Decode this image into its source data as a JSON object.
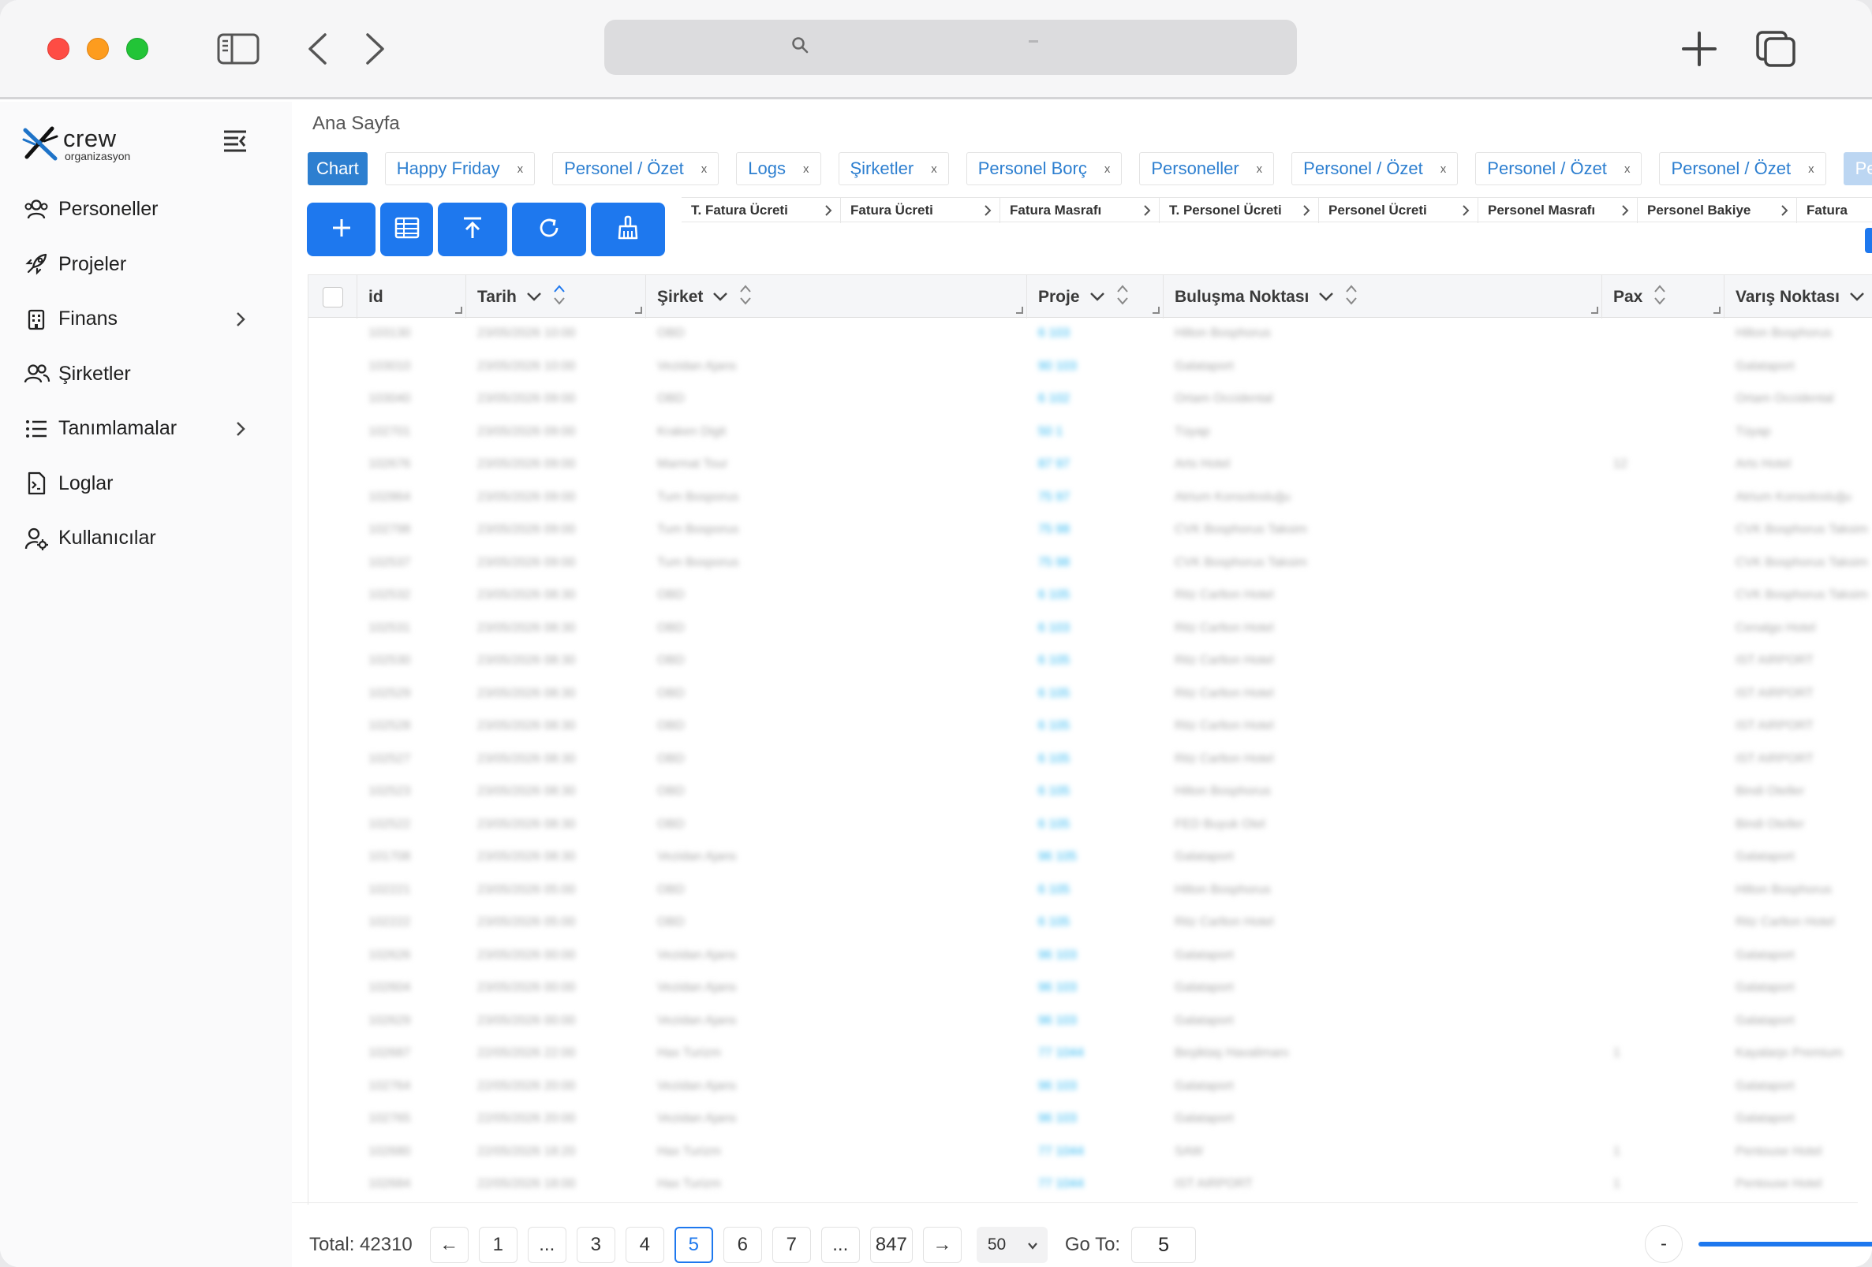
{
  "colors": {
    "accent": "#1e78ee",
    "tab_text": "#2d7fd0",
    "link": "#2bb5f0"
  },
  "titlebar": {
    "icons": [
      "sidebar-toggle-icon",
      "back-icon",
      "forward-icon",
      "search-icon",
      "new-tab-icon",
      "tab-overview-icon"
    ],
    "url_text": ""
  },
  "brand": {
    "name": "crew",
    "sub": "organizasyon"
  },
  "sidebar": {
    "items": [
      {
        "label": "Personeller",
        "icon": "users-icon",
        "has_submenu": false
      },
      {
        "label": "Projeler",
        "icon": "rocket-icon",
        "has_submenu": false
      },
      {
        "label": "Finans",
        "icon": "building-icon",
        "has_submenu": true
      },
      {
        "label": "Şirketler",
        "icon": "people-icon",
        "has_submenu": false
      },
      {
        "label": "Tanımlamalar",
        "icon": "list-icon",
        "has_submenu": true
      },
      {
        "label": "Loglar",
        "icon": "log-file-icon",
        "has_submenu": false
      },
      {
        "label": "Kullanıcılar",
        "icon": "user-settings-icon",
        "has_submenu": false
      }
    ]
  },
  "breadcrumb": "Ana Sayfa",
  "tabs": [
    {
      "label": "Chart",
      "active": true,
      "closable": false
    },
    {
      "label": "Happy Friday",
      "active": false,
      "closable": true
    },
    {
      "label": "Personel / Özet",
      "active": false,
      "closable": true
    },
    {
      "label": "Logs",
      "active": false,
      "closable": true
    },
    {
      "label": "Şirketler",
      "active": false,
      "closable": true
    },
    {
      "label": "Personel Borç",
      "active": false,
      "closable": true
    },
    {
      "label": "Personeller",
      "active": false,
      "closable": true
    },
    {
      "label": "Personel / Özet",
      "active": false,
      "closable": true
    },
    {
      "label": "Personel / Özet",
      "active": false,
      "closable": true
    },
    {
      "label": "Personel / Özet",
      "active": false,
      "closable": true
    },
    {
      "label": "Per",
      "active": false,
      "closable": false,
      "faded": true
    }
  ],
  "tab_close_symbol": "x",
  "toolbar": {
    "buttons": [
      {
        "name": "add-button",
        "icon": "plus-icon"
      },
      {
        "name": "columns-button",
        "icon": "columns-icon"
      },
      {
        "name": "export-button",
        "icon": "upload-icon"
      },
      {
        "name": "refresh-button",
        "icon": "refresh-icon"
      },
      {
        "name": "clear-filters-button",
        "icon": "broom-icon"
      }
    ]
  },
  "summary_chips": [
    "T. Fatura Ücreti",
    "Fatura Ücreti",
    "Fatura Masrafı",
    "T. Personel Ücreti",
    "Personel Ücreti",
    "Personel Masrafı",
    "Personel Bakiye",
    "Fatura"
  ],
  "table": {
    "columns": [
      "id",
      "Tarih",
      "Şirket",
      "Proje",
      "Buluşma Noktası",
      "Pax",
      "Varış Noktası"
    ],
    "rows_note_blurred": true,
    "rows": [
      [
        "103130",
        "23/05/2026 10:00",
        "OBD",
        "6 103",
        "Hilton Bosphorus",
        "",
        "Hilton Bosphorus"
      ],
      [
        "103010",
        "23/05/2026 10:00",
        "Vezidan Ajans",
        "90 103",
        "Galataport",
        "",
        "Galataport"
      ],
      [
        "103040",
        "23/05/2026 09:00",
        "OBD",
        "6 102",
        "Ortam Occidental",
        "",
        "Ortam Occidental"
      ],
      [
        "102701",
        "23/05/2026 09:00",
        "Kraken Digit",
        "50 1",
        "Tüyap",
        "",
        "Tüyap"
      ],
      [
        "102676",
        "23/05/2026 09:00",
        "Marmat Tour",
        "87 97",
        "Arts Hotel",
        "12",
        "Arts Hotel"
      ],
      [
        "102864",
        "23/05/2026 09:00",
        "Tum Bosporus",
        "75 97",
        "Atrium Konsolosluğu",
        "",
        "Atrium Konsolosluğu"
      ],
      [
        "102798",
        "23/05/2026 09:00",
        "Tum Bosporus",
        "75 98",
        "CVK Bosphorus Taksim",
        "",
        "CVK Bosphorus Taksim"
      ],
      [
        "102537",
        "23/05/2026 09:00",
        "Tum Bosporus",
        "75 98",
        "CVK Bosphorus Taksim",
        "",
        "CVK Bosphorus Taksim"
      ],
      [
        "102532",
        "23/05/2026 08:30",
        "OBD",
        "6 105",
        "Ritz Carlton Hotel",
        "",
        "CVK Bosphorus Taksim"
      ],
      [
        "102531",
        "23/05/2026 08:30",
        "OBD",
        "6 103",
        "Ritz Carlton Hotel",
        "",
        "Cenalgo Hotel"
      ],
      [
        "102530",
        "23/05/2026 08:30",
        "OBD",
        "6 105",
        "Ritz Carlton Hotel",
        "",
        "IST AIRPORT"
      ],
      [
        "102529",
        "23/05/2026 08:30",
        "OBD",
        "6 105",
        "Ritz Carlton Hotel",
        "",
        "IST AIRPORT"
      ],
      [
        "102528",
        "23/05/2026 08:30",
        "OBD",
        "6 105",
        "Ritz Carlton Hotel",
        "",
        "IST AIRPORT"
      ],
      [
        "102527",
        "23/05/2026 08:30",
        "OBD",
        "6 105",
        "Ritz Carlton Hotel",
        "",
        "IST AIRPORT"
      ],
      [
        "102523",
        "23/05/2026 08:30",
        "OBD",
        "6 105",
        "Hilton Bosphorus",
        "",
        "Bindi Oteller"
      ],
      [
        "102522",
        "23/05/2026 08:30",
        "OBD",
        "6 105",
        "FED Buyuk Otel",
        "",
        "Bindi Oteller"
      ],
      [
        "101708",
        "23/05/2026 08:30",
        "Vezidan Ajans",
        "96 105",
        "Galataport",
        "",
        "Galataport"
      ],
      [
        "102221",
        "23/05/2026 05:00",
        "OBD",
        "6 105",
        "Hilton Bosphorus",
        "",
        "Hilton Bosphorus"
      ],
      [
        "102222",
        "23/05/2026 05:00",
        "OBD",
        "6 105",
        "Ritz Carlton Hotel",
        "",
        "Ritz Carlton Hotel"
      ],
      [
        "102626",
        "23/05/2026 00:00",
        "Vezidan Ajans",
        "96 103",
        "Galataport",
        "",
        "Galataport"
      ],
      [
        "102604",
        "23/05/2026 00:00",
        "Vezidan Ajans",
        "96 103",
        "Galataport",
        "",
        "Galataport"
      ],
      [
        "102629",
        "23/05/2026 00:00",
        "Vezidan Ajans",
        "96 103",
        "Galataport",
        "",
        "Galataport"
      ],
      [
        "102687",
        "22/05/2026 22:00",
        "Hax Turizm",
        "77 1044",
        "Beşiktaş Havalimanı",
        "1",
        "Kayalarpı Premium"
      ],
      [
        "102764",
        "22/05/2026 20:00",
        "Vezidan Ajans",
        "96 103",
        "Galataport",
        "",
        "Galataport"
      ],
      [
        "102765",
        "22/05/2026 20:00",
        "Vezidan Ajans",
        "96 103",
        "Galataport",
        "",
        "Galataport"
      ],
      [
        "102680",
        "22/05/2026 18:20",
        "Hax Turizm",
        "77 1044",
        "SAW",
        "1",
        "Pentouse Hotel"
      ],
      [
        "102684",
        "22/05/2026 18:00",
        "Hax Turizm",
        "77 1044",
        "IST AIRPORT",
        "1",
        "Pentouse Hotel"
      ]
    ]
  },
  "pagination": {
    "total_label": "Total: 42310",
    "prev_symbol": "←",
    "next_symbol": "→",
    "pages": [
      "1",
      "...",
      "3",
      "4",
      "5",
      "6",
      "7",
      "...",
      "847"
    ],
    "current_page": "5",
    "per_page": "50",
    "goto_label": "Go To:",
    "goto_value": "5"
  },
  "zoom": {
    "minus_label": "-"
  }
}
